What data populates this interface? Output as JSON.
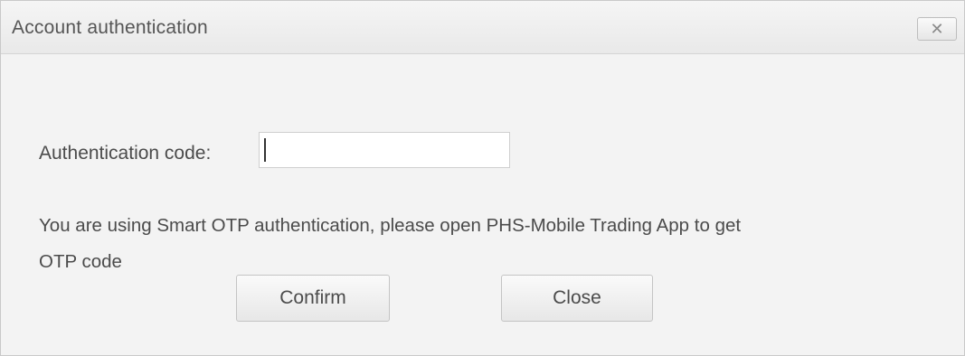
{
  "dialog": {
    "title": "Account authentication",
    "close_icon_glyph": "✕",
    "auth_label": "Authentication code:",
    "auth_input_value": "",
    "message_line1": "You are using Smart OTP authentication, please open PHS-Mobile Trading App to get",
    "message_line2": "OTP code",
    "confirm_label": "Confirm",
    "close_label": "Close"
  }
}
